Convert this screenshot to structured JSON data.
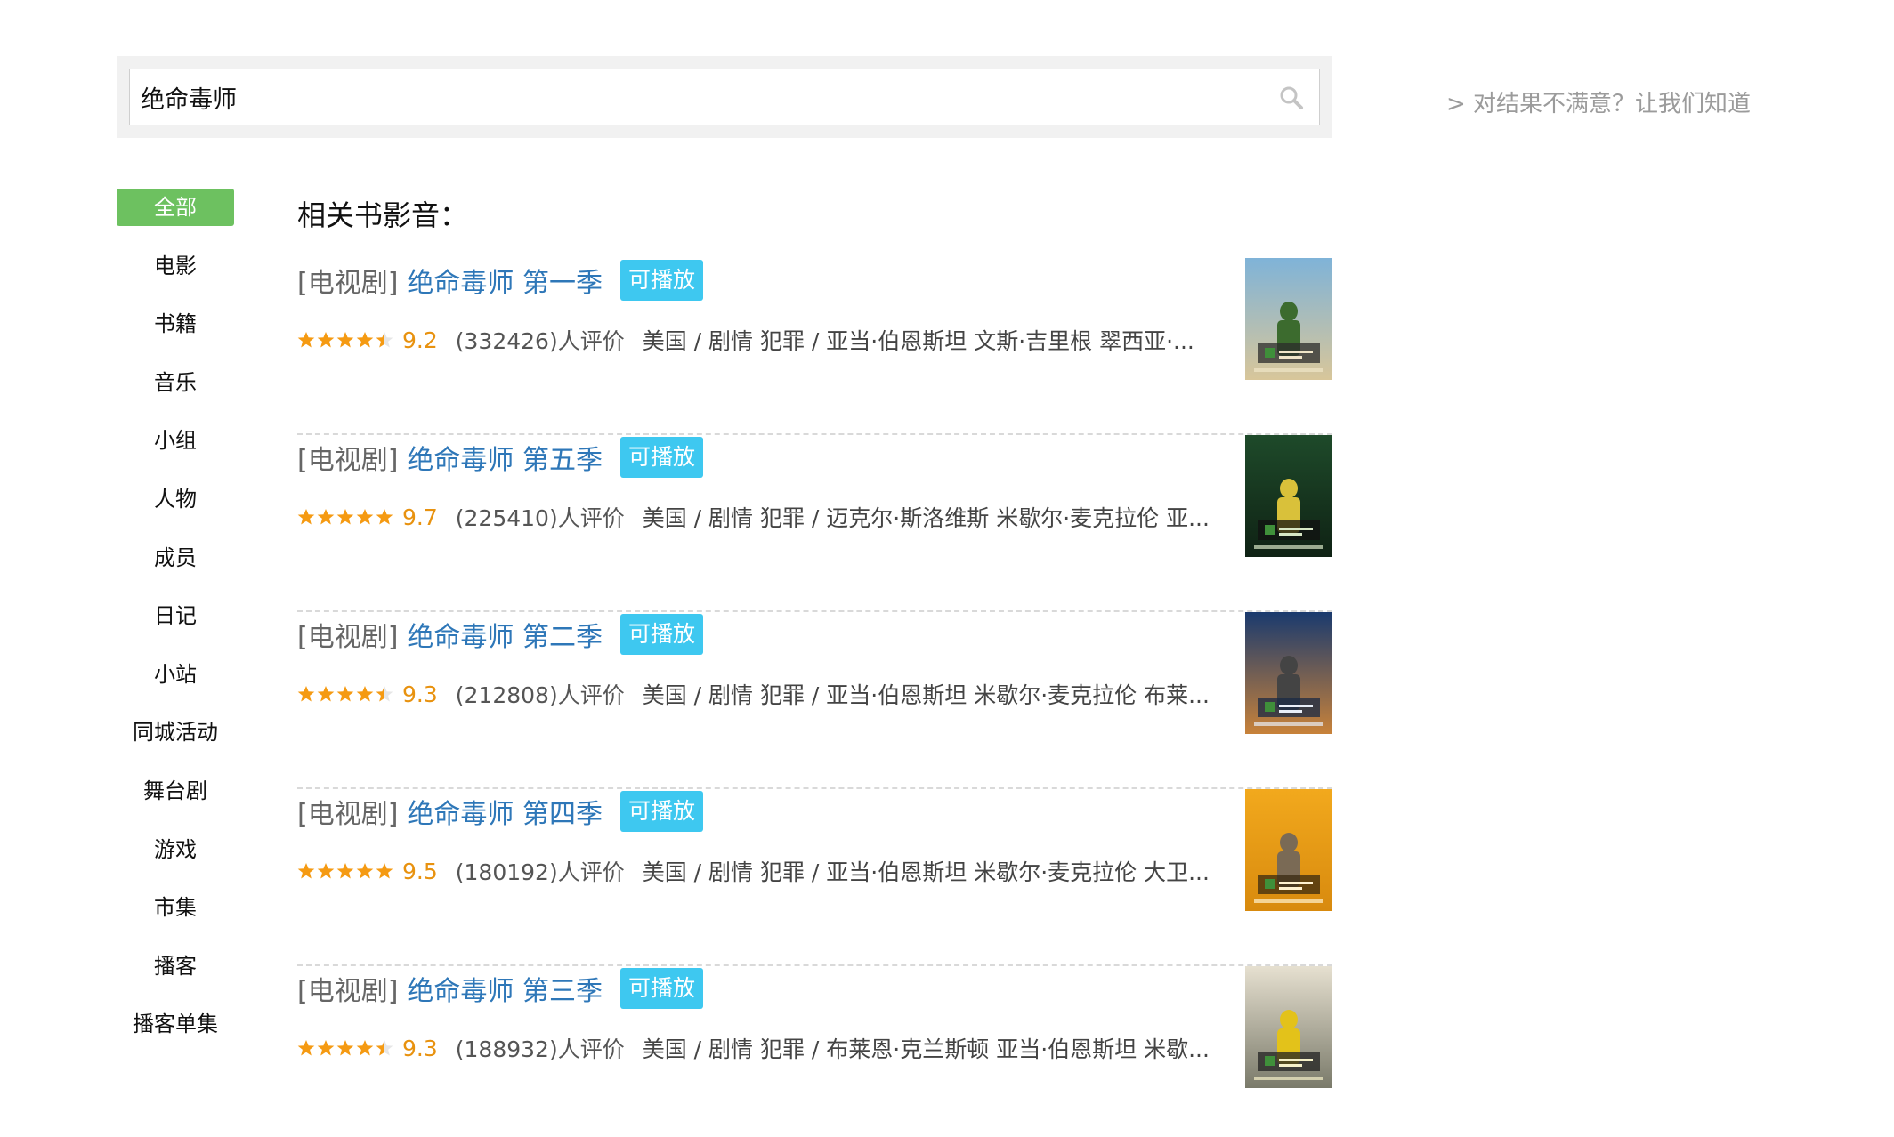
{
  "search": {
    "query": "绝命毒师",
    "feedback_link": "> 对结果不满意？让我们知道"
  },
  "sidebar": {
    "categories": [
      {
        "label": "全部",
        "active": true
      },
      {
        "label": "电影"
      },
      {
        "label": "书籍"
      },
      {
        "label": "音乐"
      },
      {
        "label": "小组"
      },
      {
        "label": "人物"
      },
      {
        "label": "成员"
      },
      {
        "label": "日记"
      },
      {
        "label": "小站"
      },
      {
        "label": "同城活动"
      },
      {
        "label": "舞台剧"
      },
      {
        "label": "游戏"
      },
      {
        "label": "市集"
      },
      {
        "label": "播客"
      },
      {
        "label": "播客单集"
      }
    ]
  },
  "results": {
    "section_title": "相关书影音：",
    "items": [
      {
        "type": "[电视剧]",
        "title": "绝命毒师 第一季",
        "badge": "可播放",
        "stars": 4.5,
        "rating": "9.2",
        "count": "(332426)人评价",
        "info": "美国 / 剧情 犯罪 / 亚当·伯恩斯坦 文斯·吉里根 翠西亚·...",
        "poster_icon": "breaking-bad-s1-poster"
      },
      {
        "type": "[电视剧]",
        "title": "绝命毒师 第五季",
        "badge": "可播放",
        "stars": 5,
        "rating": "9.7",
        "count": "(225410)人评价",
        "info": "美国 / 剧情 犯罪 / 迈克尔·斯洛维斯 米歇尔·麦克拉伦 亚...",
        "poster_icon": "breaking-bad-s5-poster"
      },
      {
        "type": "[电视剧]",
        "title": "绝命毒师 第二季",
        "badge": "可播放",
        "stars": 4.5,
        "rating": "9.3",
        "count": "(212808)人评价",
        "info": "美国 / 剧情 犯罪 / 亚当·伯恩斯坦 米歇尔·麦克拉伦 布莱...",
        "poster_icon": "breaking-bad-s2-poster"
      },
      {
        "type": "[电视剧]",
        "title": "绝命毒师 第四季",
        "badge": "可播放",
        "stars": 5,
        "rating": "9.5",
        "count": "(180192)人评价",
        "info": "美国 / 剧情 犯罪 / 亚当·伯恩斯坦 米歇尔·麦克拉伦 大卫...",
        "poster_icon": "breaking-bad-s4-poster"
      },
      {
        "type": "[电视剧]",
        "title": "绝命毒师 第三季",
        "badge": "可播放",
        "stars": 4.5,
        "rating": "9.3",
        "count": "(188932)人评价",
        "info": "美国 / 剧情 犯罪 / 布莱恩·克兰斯顿 亚当·伯恩斯坦 米歇...",
        "poster_icon": "breaking-bad-s3-poster"
      }
    ]
  },
  "colors": {
    "accent_green": "#6dc160",
    "link_blue": "#2e77b8",
    "badge_cyan": "#3ec8f0",
    "star_orange": "#f59a12"
  }
}
